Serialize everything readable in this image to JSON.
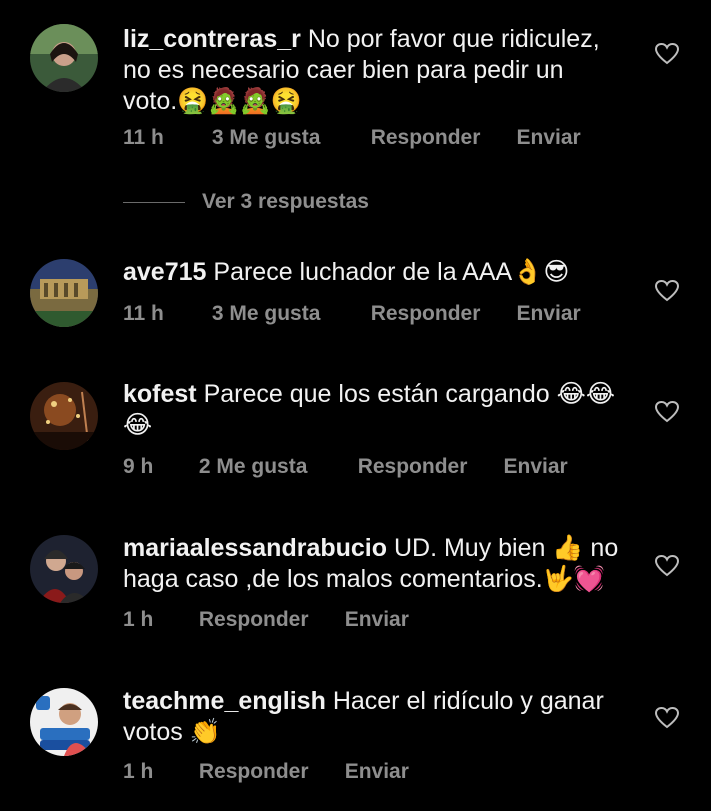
{
  "comments": [
    {
      "username": "liz_contreras_r",
      "text": "No por favor que ridiculez, no es necesario caer bien para pedir un voto.🤮🧟🧟🤮",
      "time": "11 h",
      "likes": "3 Me gusta",
      "reply_label": "Responder",
      "send_label": "Enviar",
      "avatar_icon": "user-avatar-icon"
    },
    {
      "username": "ave715",
      "text": "Parece luchador  de la AAA👌😎",
      "time": "11 h",
      "likes": "3 Me gusta",
      "reply_label": "Responder",
      "send_label": "Enviar",
      "avatar_icon": "user-avatar-icon"
    },
    {
      "username": "kofest",
      "text": "Parece que los están cargando 😂😂😂",
      "time": "9 h",
      "likes": "2 Me gusta",
      "reply_label": "Responder",
      "send_label": "Enviar",
      "avatar_icon": "user-avatar-icon"
    },
    {
      "username": "mariaalessandrabucio",
      "text": "UD. Muy bien 👍 no haga caso ,de los malos comentarios.🤟💓",
      "time": "1 h",
      "reply_label": "Responder",
      "send_label": "Enviar",
      "avatar_icon": "user-avatar-icon"
    },
    {
      "username": "teachme_english",
      "text": "Hacer el ridículo y ganar votos 👏",
      "time": "1 h",
      "reply_label": "Responder",
      "send_label": "Enviar",
      "avatar_icon": "user-avatar-icon"
    }
  ],
  "view_replies_label": "Ver 3 respuestas",
  "colors": {
    "background": "#000000",
    "meta": "#8e8e8e",
    "text": "#f2f2f2"
  }
}
